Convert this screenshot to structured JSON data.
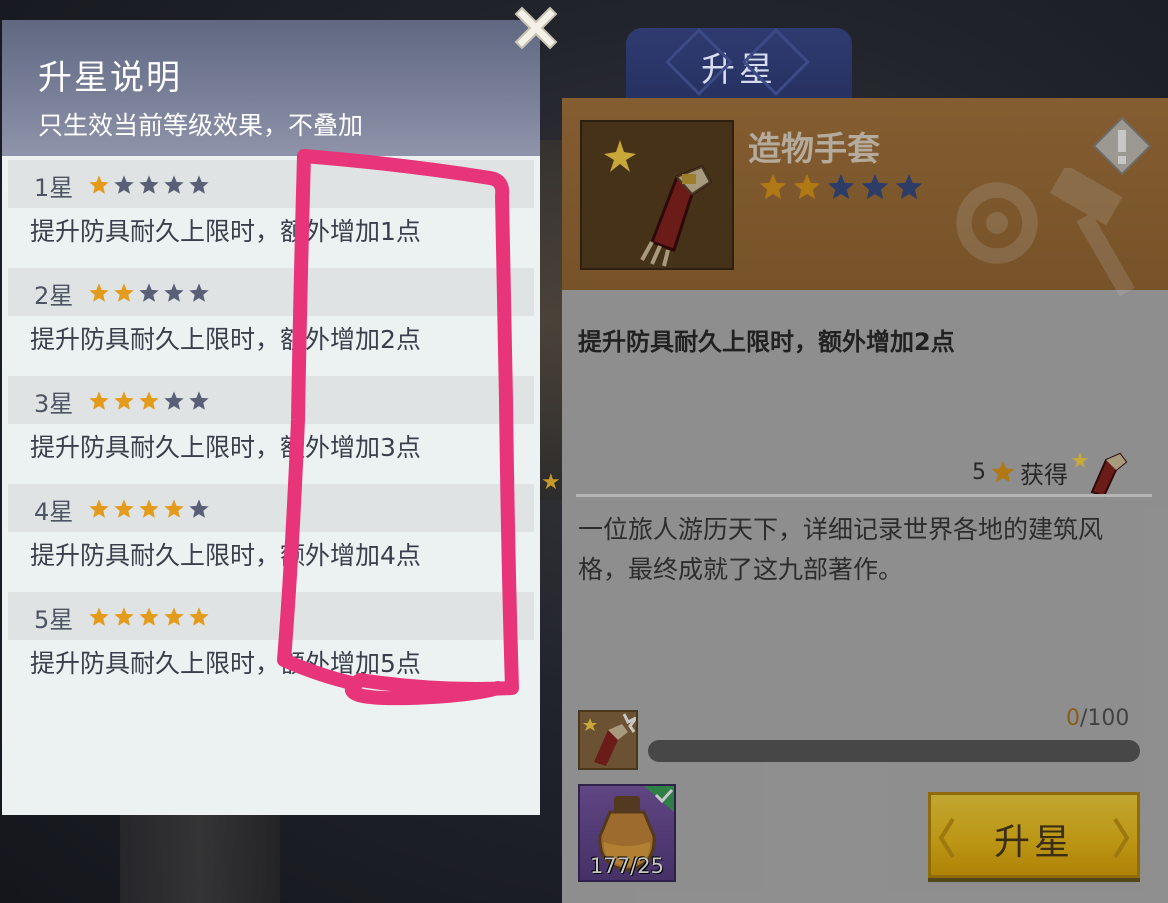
{
  "popup": {
    "title": "升星说明",
    "subtitle": "只生效当前等级效果，不叠加",
    "levels": [
      {
        "name": "1星",
        "stars_filled": 1,
        "stars_total": 5,
        "desc": "提升防具耐久上限时，额外增加1点"
      },
      {
        "name": "2星",
        "stars_filled": 2,
        "stars_total": 5,
        "desc": "提升防具耐久上限时，额外增加2点"
      },
      {
        "name": "3星",
        "stars_filled": 3,
        "stars_total": 5,
        "desc": "提升防具耐久上限时，额外增加3点"
      },
      {
        "name": "4星",
        "stars_filled": 4,
        "stars_total": 5,
        "desc": "提升防具耐久上限时，额外增加4点"
      },
      {
        "name": "5星",
        "stars_filled": 5,
        "stars_total": 5,
        "desc": "提升防具耐久上限时，额外增加5点"
      }
    ]
  },
  "tab": {
    "label": "升星"
  },
  "item": {
    "name": "造物手套",
    "stars_filled": 2,
    "stars_total": 5,
    "effect": "提升防具耐久上限时，额外增加2点",
    "obtain_count": "5",
    "obtain_label": "获得",
    "lore": "一位旅人游历天下，详细记录世界各地的建筑风格，最终成就了这九部著作。"
  },
  "upgrade": {
    "progress_current": "0",
    "progress_max": "/100",
    "progress_fraction": 0,
    "potion_count": "177/25",
    "button_label": "升星"
  },
  "icons": {
    "close": "close-icon",
    "warning": "warning-icon",
    "gauntlet": "gauntlet-icon",
    "potion": "potion-icon",
    "check": "check-icon"
  },
  "colors": {
    "star_filled": "#e39b1c",
    "star_empty_popup": "#5a5f78",
    "star_empty_item": "#3b4e86",
    "annotation": "#e8357a",
    "button": "#f2c21c"
  }
}
